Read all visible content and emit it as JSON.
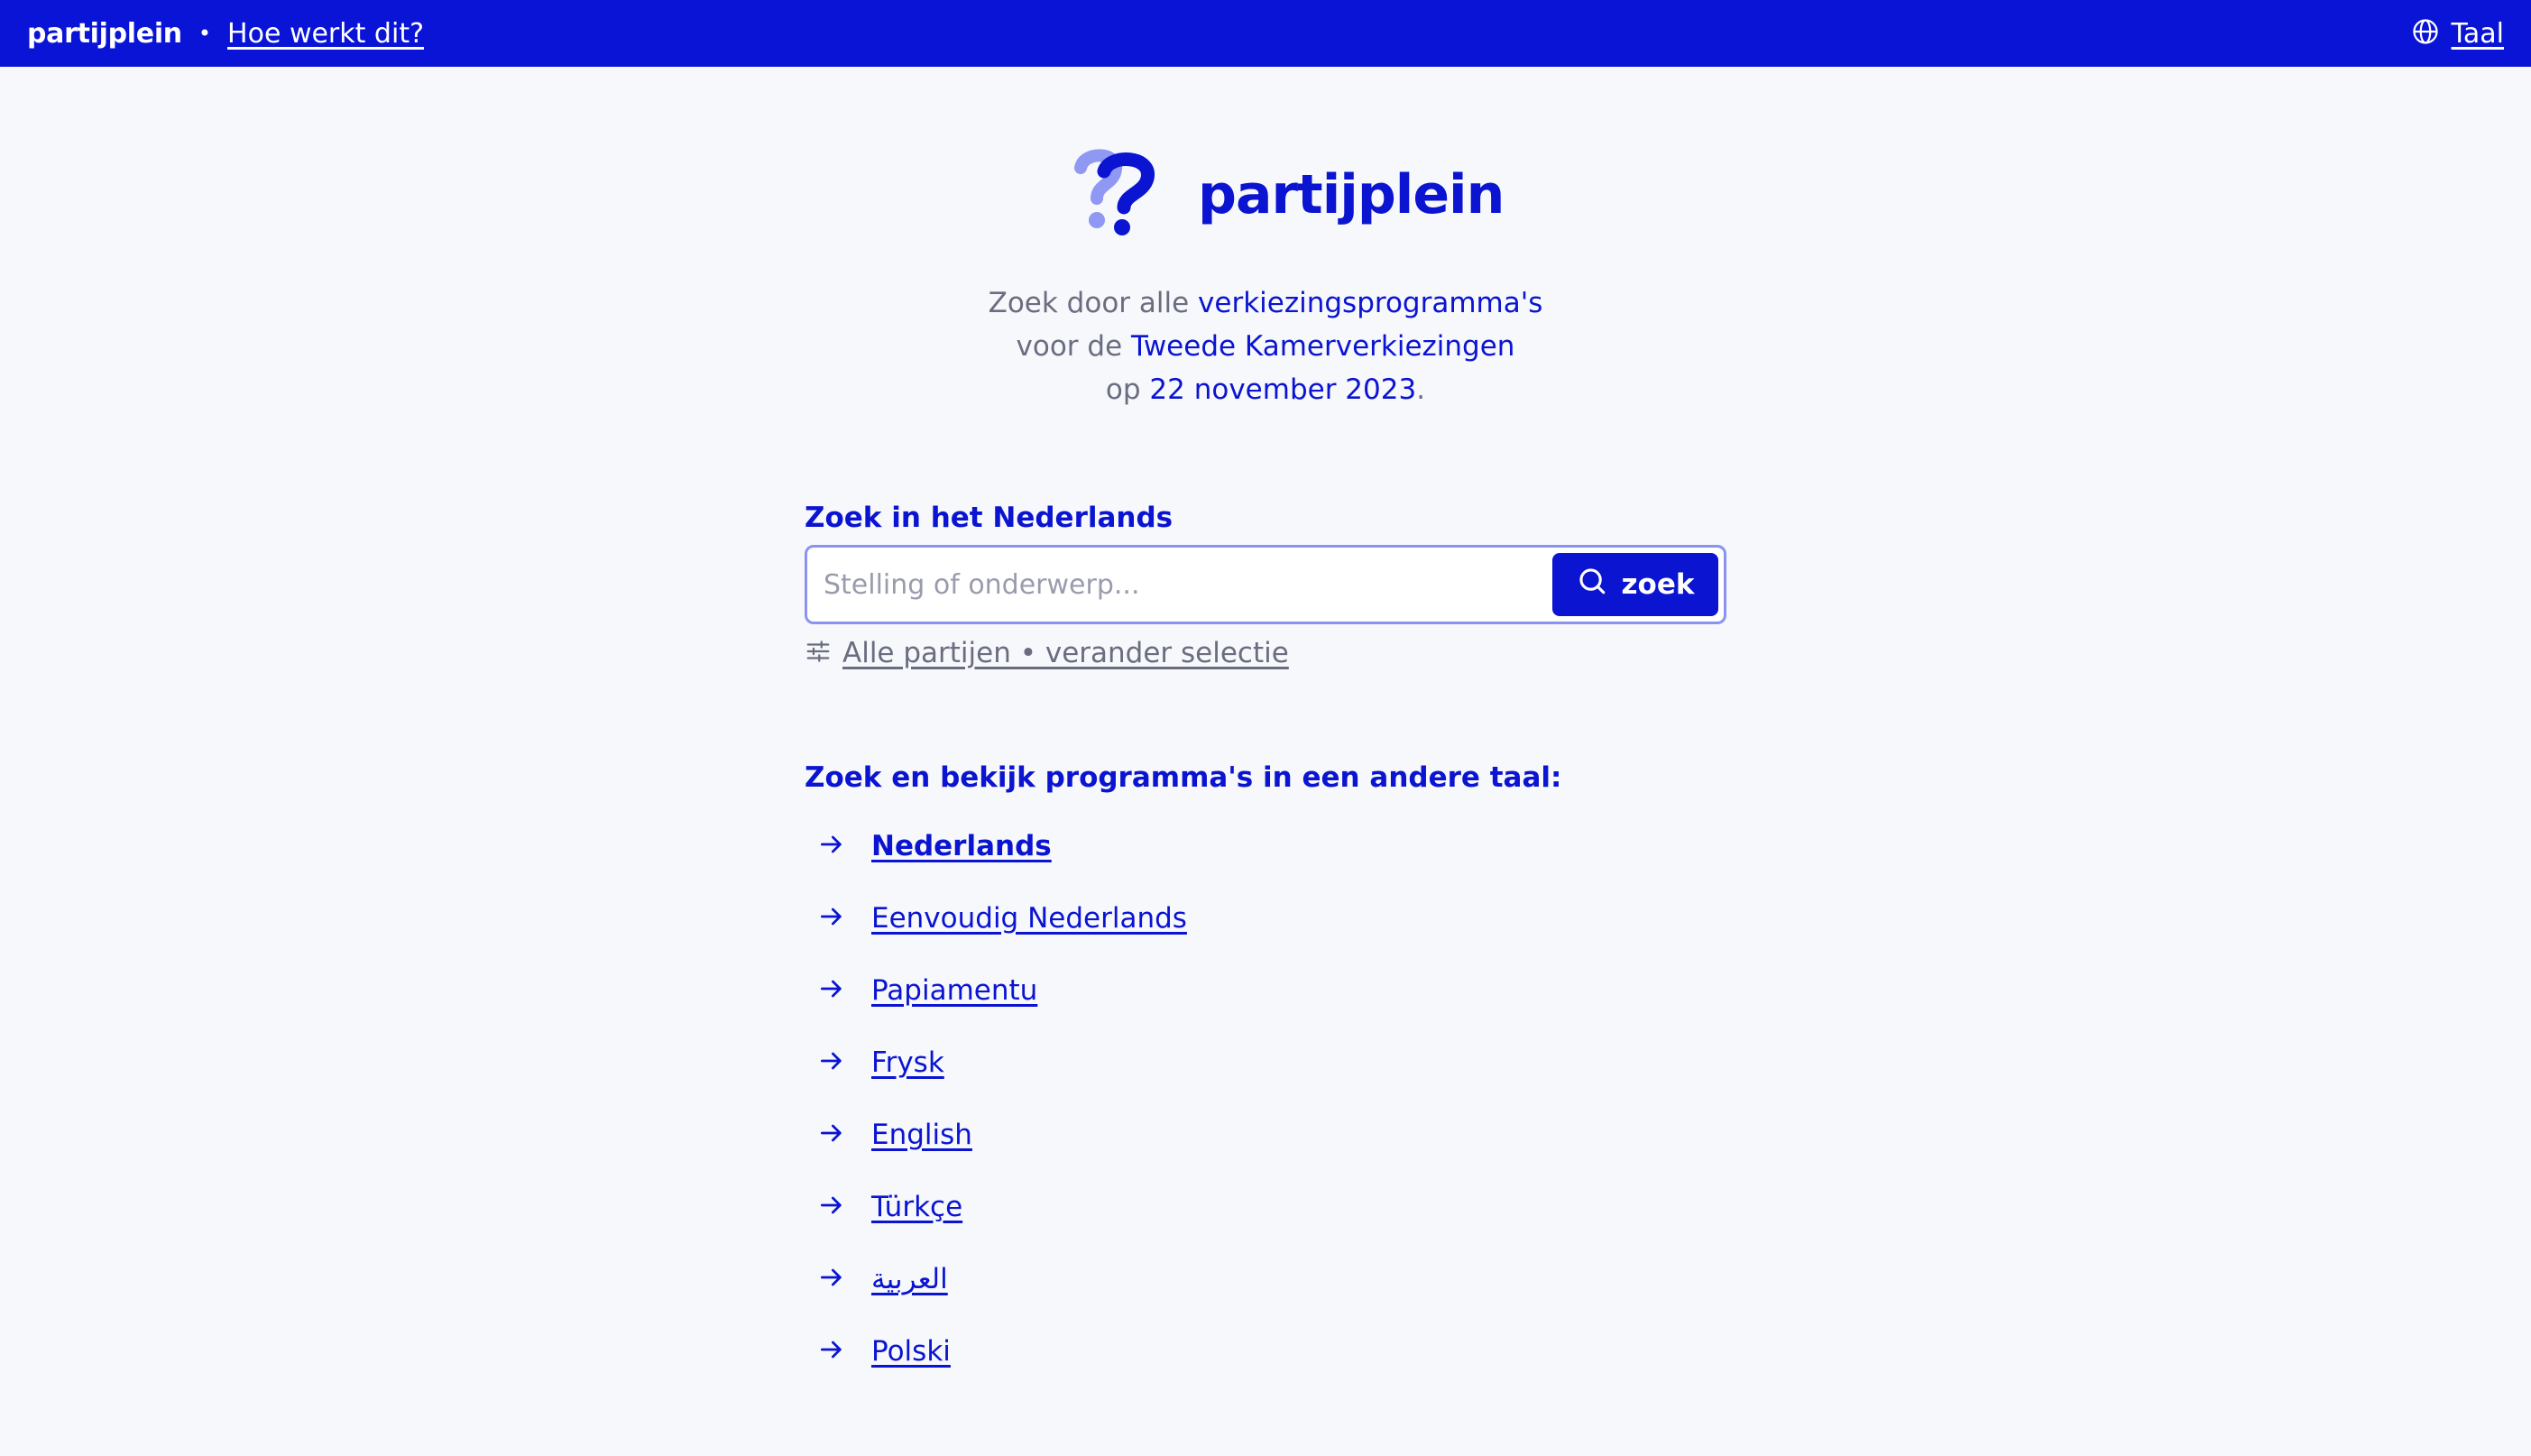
{
  "topbar": {
    "brand": "partijplein",
    "separator": "•",
    "howto_link": "Hoe werkt dit?",
    "language_label": "Taal",
    "language_icon": "globe-icon"
  },
  "hero": {
    "logo_icon": "question-mark-logo",
    "wordmark": "partijplein",
    "intro_line1_prefix": "Zoek door alle ",
    "intro_line1_highlight": "verkiezingsprogramma's",
    "intro_line2_prefix": "voor de ",
    "intro_line2_highlight": "Tweede Kamerverkiezingen",
    "intro_line3_prefix": "op ",
    "intro_line3_highlight": "22 november 2023",
    "intro_line3_suffix": "."
  },
  "search": {
    "label": "Zoek in het Nederlands",
    "placeholder": "Stelling of onderwerp...",
    "value": "",
    "button_label": "zoek",
    "button_icon": "search-icon",
    "filter_icon": "sliders-icon",
    "filter_link": "Alle partijen • verander selectie"
  },
  "languages": {
    "heading": "Zoek en bekijk programma's in een andere taal:",
    "arrow_icon": "arrow-right-icon",
    "items": [
      {
        "label": "Nederlands",
        "current": true
      },
      {
        "label": "Eenvoudig Nederlands",
        "current": false
      },
      {
        "label": "Papiamentu",
        "current": false
      },
      {
        "label": "Frysk",
        "current": false
      },
      {
        "label": "English",
        "current": false
      },
      {
        "label": "Türkçe",
        "current": false
      },
      {
        "label": "العربية",
        "current": false
      },
      {
        "label": "Polski",
        "current": false
      }
    ]
  },
  "colors": {
    "brand_blue": "#0a14d6",
    "text_blue": "#0a14d1",
    "logo_light": "#8f98f3",
    "muted_text": "#6a6d80",
    "page_bg": "#f7f8fb",
    "input_border": "#8a93f0"
  }
}
